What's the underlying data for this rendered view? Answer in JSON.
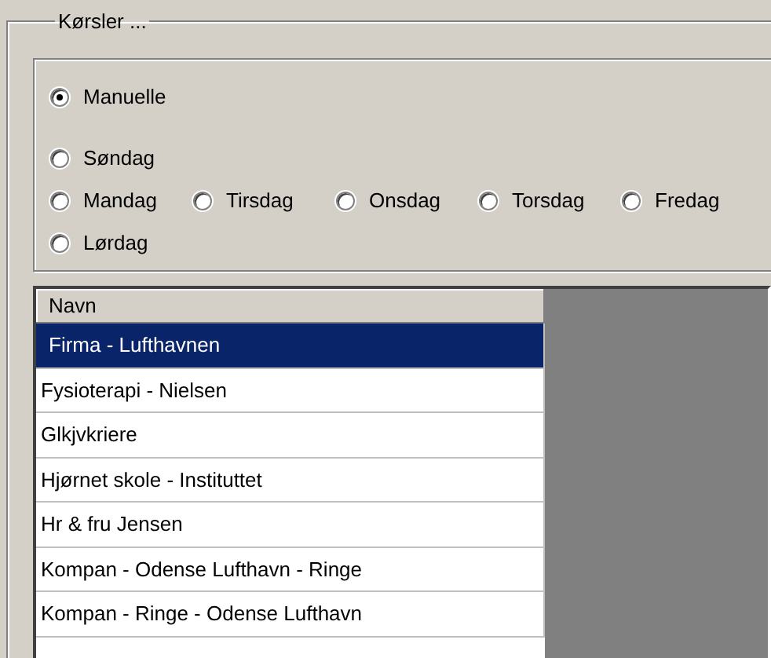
{
  "group": {
    "title": "Kørsler ..."
  },
  "radio_rows": [
    [
      {
        "label": "Manuelle",
        "selected": true
      }
    ],
    [
      {
        "label": "Søndag",
        "selected": false
      }
    ],
    [
      {
        "label": "Mandag",
        "selected": false
      },
      {
        "label": "Tirsdag",
        "selected": false
      },
      {
        "label": "Onsdag",
        "selected": false
      },
      {
        "label": "Torsdag",
        "selected": false
      },
      {
        "label": "Fredag",
        "selected": false
      }
    ],
    [
      {
        "label": "Lørdag",
        "selected": false
      }
    ]
  ],
  "table": {
    "columns": [
      "Navn"
    ],
    "rows": [
      {
        "cells": [
          "Firma - Lufthavnen"
        ],
        "selected": true
      },
      {
        "cells": [
          "Fysioterapi - Nielsen"
        ],
        "selected": false
      },
      {
        "cells": [
          "Glkjvkriere"
        ],
        "selected": false
      },
      {
        "cells": [
          "Hjørnet skole - Instituttet"
        ],
        "selected": false
      },
      {
        "cells": [
          "Hr & fru Jensen"
        ],
        "selected": false
      },
      {
        "cells": [
          "Kompan - Odense Lufthavn - Ringe"
        ],
        "selected": false
      },
      {
        "cells": [
          "Kompan - Ringe - Odense Lufthavn"
        ],
        "selected": false
      }
    ]
  }
}
